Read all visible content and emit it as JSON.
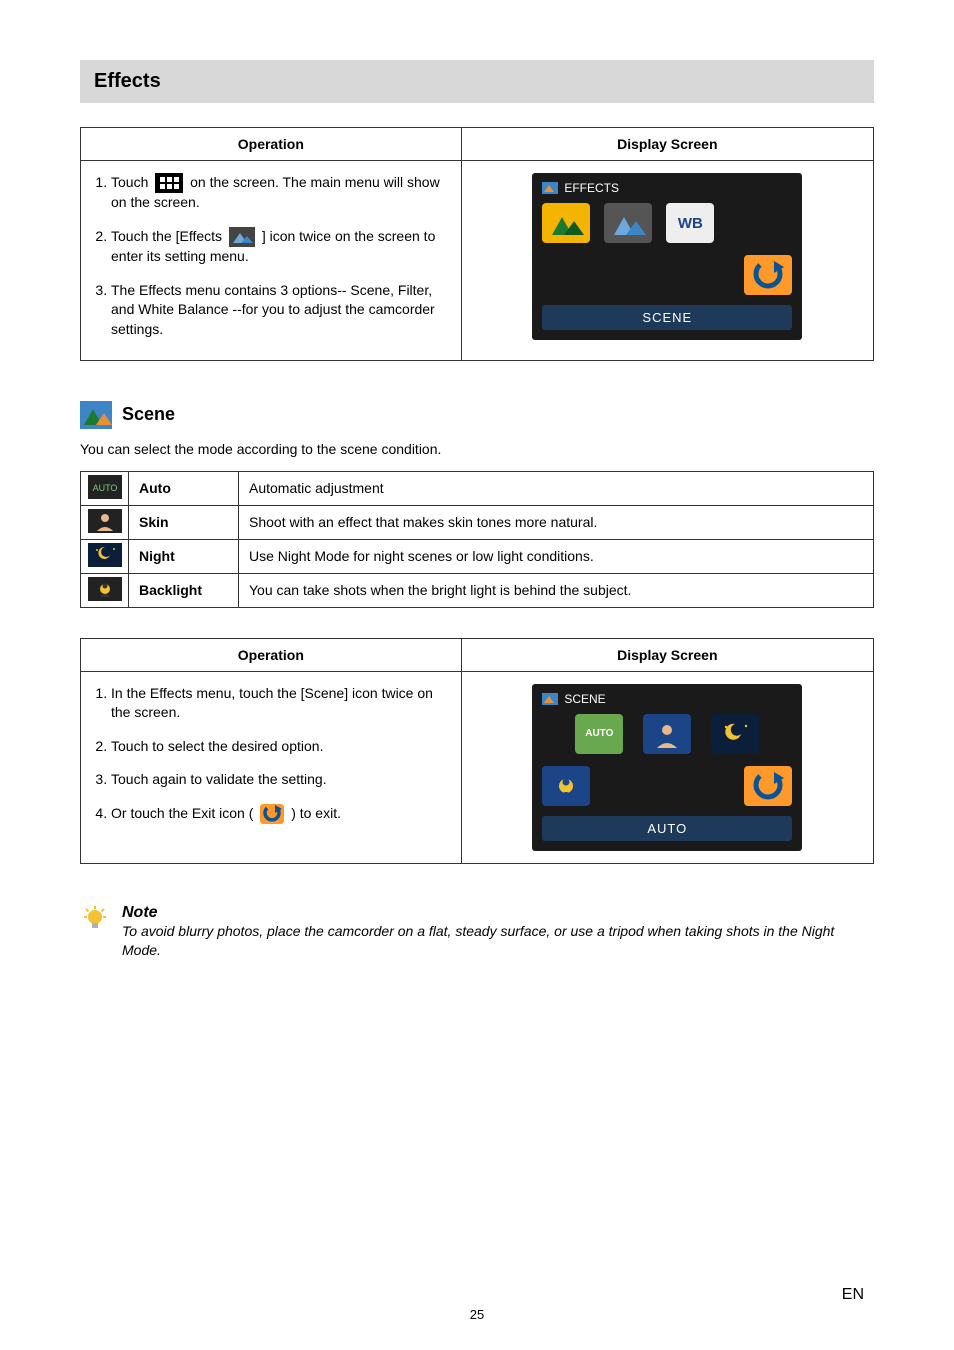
{
  "heading": "Effects",
  "table1": {
    "col1": "Operation",
    "col2": "Display Screen",
    "steps": [
      {
        "pre": "Touch ",
        "post": " on the screen. The main menu will show on the screen."
      },
      {
        "pre": "Touch the [Effects ",
        "post": " ] icon twice on the screen to enter its setting menu."
      },
      {
        "full": "The Effects menu contains 3 options-- Scene, Filter, and White Balance --for you to adjust the camcorder settings."
      }
    ],
    "screen": {
      "title": "EFFECTS",
      "wb": "WB",
      "footer": "SCENE"
    }
  },
  "scene": {
    "title": "Scene",
    "intro": "You can select the mode according to the scene condition.",
    "rows": [
      {
        "label": "Auto",
        "desc": "Automatic adjustment"
      },
      {
        "label": "Skin",
        "desc": "Shoot with an effect that makes skin tones more natural."
      },
      {
        "label": "Night",
        "desc": "Use Night Mode for night scenes or low light conditions."
      },
      {
        "label": "Backlight",
        "desc": "You can take shots when the bright light is behind the subject."
      }
    ]
  },
  "table2": {
    "col1": "Operation",
    "col2": "Display Screen",
    "steps": [
      "In the Effects menu, touch the [Scene] icon twice on the screen.",
      "Touch to select the desired option.",
      "Touch again to validate the setting."
    ],
    "step4pre": "Or touch the Exit icon ( ",
    "step4post": " ) to exit.",
    "screen": {
      "title": "SCENE",
      "auto": "AUTO",
      "footer": "AUTO"
    }
  },
  "note": {
    "title": "Note",
    "text": "To avoid blurry photos, place the camcorder on a flat, steady surface, or use a tripod when taking shots in the Night Mode."
  },
  "pageNum": "25",
  "lang": "EN"
}
